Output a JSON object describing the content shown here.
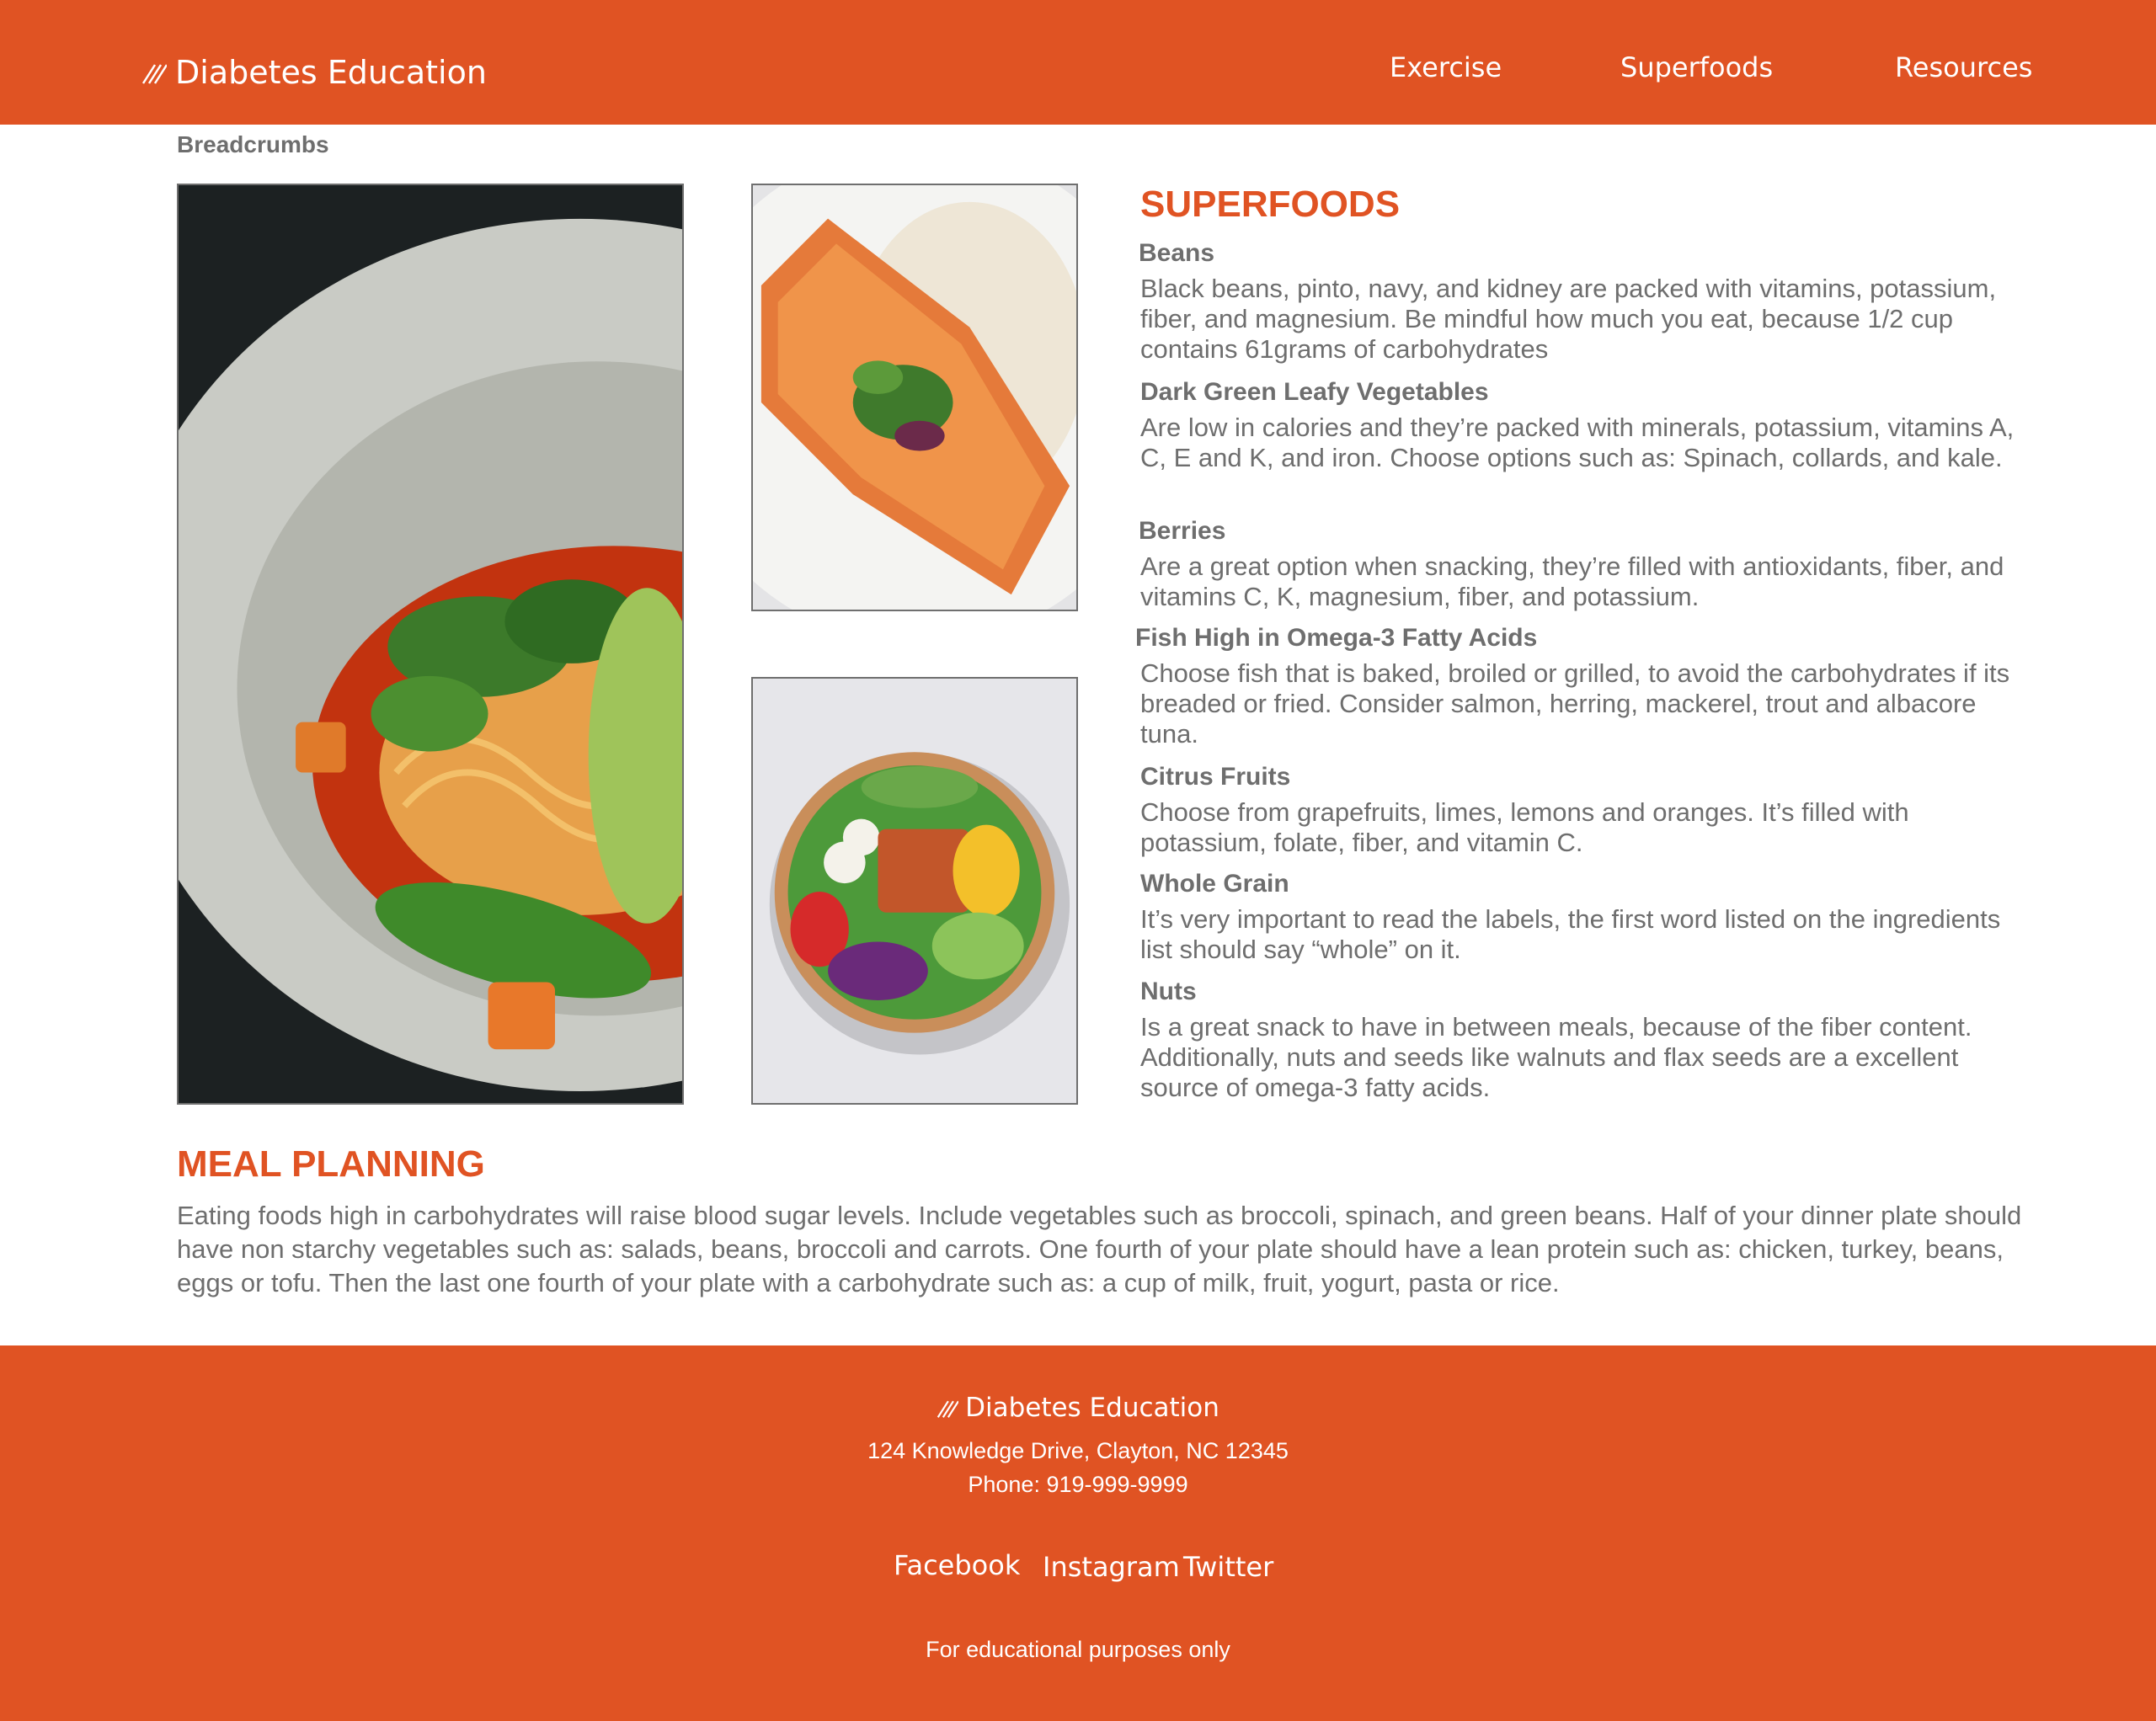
{
  "header": {
    "brand": "Diabetes Education",
    "brand_icon": "diagonal-lines-logo-icon",
    "nav": [
      "Exercise",
      "Superfoods",
      "Resources"
    ]
  },
  "breadcrumbs": "Breadcrumbs",
  "images": {
    "large": "noodle-soup-bowl-image",
    "top": "salmon-fillet-image",
    "bottom": "salad-bowl-image"
  },
  "superfoods": {
    "title": "SUPERFOODS",
    "items": [
      {
        "name": "Beans",
        "text": "Black beans, pinto, navy, and kidney are packed with vitamins, potassium, fiber, and magnesium. Be mindful how much you eat, because 1/2 cup contains 61grams of carbohydrates"
      },
      {
        "name": "Dark Green Leafy Vegetables",
        "text": "Are low in calories and they’re packed with minerals, potassium, vitamins A, C, E and K, and iron. Choose options such as: Spinach, collards, and kale."
      },
      {
        "name": "Berries",
        "text": "Are a great option when snacking, they’re filled with antioxidants, fiber, and vitamins C, K, magnesium, fiber, and potassium."
      },
      {
        "name": "Fish High in Omega-3 Fatty Acids",
        "text": "Choose fish that is baked, broiled or grilled, to avoid the carbohydrates if its breaded or fried. Consider salmon, herring, mackerel, trout and albacore tuna."
      },
      {
        "name": "Citrus Fruits",
        "text": "Choose from grapefruits, limes, lemons and oranges. It’s filled with potassium, folate, fiber, and vitamin C."
      },
      {
        "name": "Whole Grain",
        "text": "It’s very important to read the labels, the first word listed on the ingredients list should say “whole” on it."
      },
      {
        "name": "Nuts",
        "text": "Is a great snack to have in between meals, because of the fiber content. Additionally, nuts and seeds like walnuts and flax seeds are a excellent source of omega-3 fatty acids."
      }
    ]
  },
  "meal_planning": {
    "title": "MEAL PLANNING",
    "text": "Eating foods high in carbohydrates will raise blood sugar levels. Include vegetables such as broccoli, spinach, and green beans. Half of your dinner plate should have non starchy vegetables such as: salads, beans, broccoli and carrots. One fourth of your plate should have a lean protein such as: chicken, turkey, beans, eggs or tofu. Then the last one fourth of your plate with a carbohydrate such as: a cup of milk, fruit, yogurt, pasta or rice."
  },
  "footer": {
    "brand": "Diabetes Education",
    "address": "124 Knowledge Drive, Clayton, NC 12345",
    "phone": "Phone: 919-999-9999",
    "social": [
      "Facebook",
      "Instagram",
      "Twitter"
    ],
    "disclaimer": "For educational purposes only"
  },
  "colors": {
    "brand": "#e05323",
    "text": "#6e6e6e",
    "background": "#ffffff"
  }
}
